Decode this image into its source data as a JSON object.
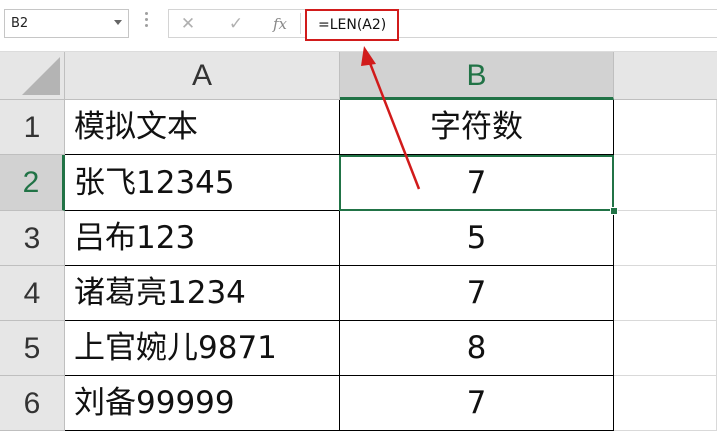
{
  "formula_bar": {
    "name_box": "B2",
    "formula": "=LEN(A2)",
    "icons": [
      "cancel-icon",
      "enter-check-icon",
      "insert-function-icon"
    ],
    "fx_label": "fx",
    "cancel_glyph": "✕",
    "enter_glyph": "✓"
  },
  "grid": {
    "columns": [
      "A",
      "B"
    ],
    "active_column": "B",
    "active_row": "2",
    "rows": [
      {
        "num": "1",
        "a": "模拟文本",
        "b": "字符数"
      },
      {
        "num": "2",
        "a": "张飞12345",
        "b": "7"
      },
      {
        "num": "3",
        "a": "吕布123",
        "b": "5"
      },
      {
        "num": "4",
        "a": "诸葛亮1234",
        "b": "7"
      },
      {
        "num": "5",
        "a": "上官婉儿9871",
        "b": "8"
      },
      {
        "num": "6",
        "a": "刘备99999",
        "b": "7"
      }
    ]
  },
  "annotation": {
    "color": "#d11b1b"
  },
  "accent": "#217346"
}
